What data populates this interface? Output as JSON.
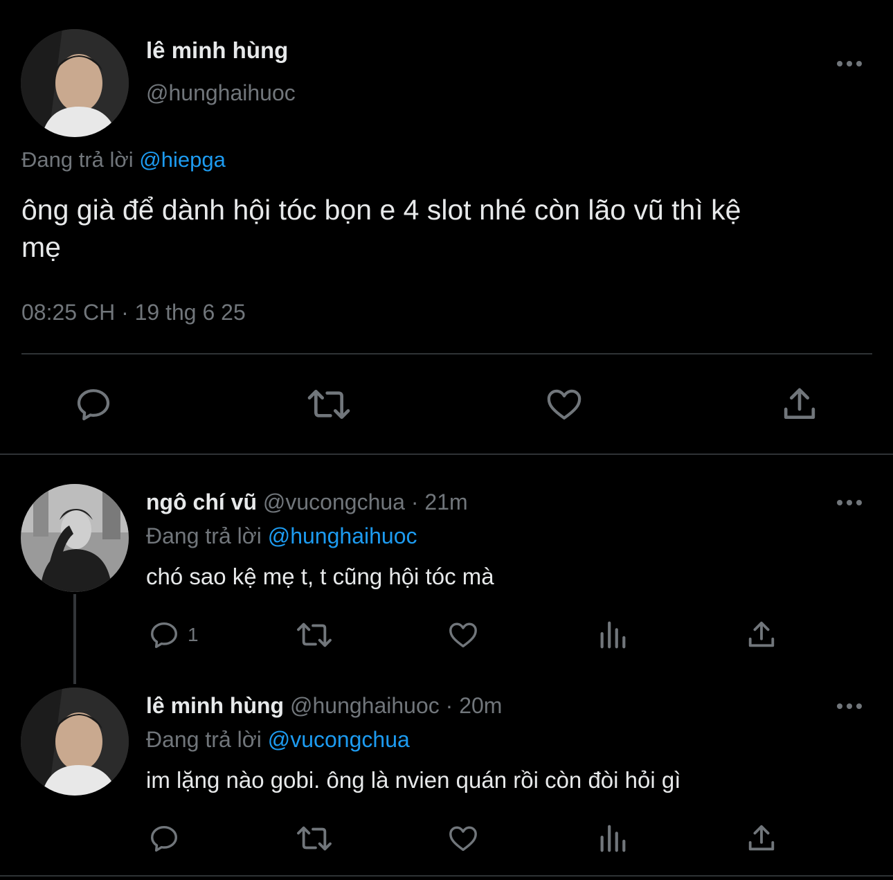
{
  "main_tweet": {
    "author_name": "lê minh hùng",
    "handle": "@hunghaihuoc",
    "reply_prefix": "Đang trả lời",
    "reply_to": "@hiepga",
    "text_line1": "ông già để dành hội tóc bọn e 4 slot nhé còn lão vũ thì kệ",
    "text_line2": "mẹ",
    "timestamp": "08:25 CH · 19 thg 6 25"
  },
  "replies": [
    {
      "author_name": "ngô chí vũ",
      "handle": "@vucongchua",
      "time": "· 21m",
      "reply_prefix": "Đang trả lời",
      "reply_to": "@hunghaihuoc",
      "text": "chó sao kệ mẹ t, t cũng hội tóc mà",
      "reply_count": "1"
    },
    {
      "author_name": "lê minh hùng",
      "handle": "@hunghaihuoc",
      "time": "· 20m",
      "reply_prefix": "Đang trả lời",
      "reply_to": "@vucongchua",
      "text": "im lặng nào gobi. ông là nvien quán rồi còn đòi hỏi gì",
      "reply_count": ""
    }
  ],
  "icons": [
    "reply-icon",
    "retweet-icon",
    "like-icon",
    "share-icon",
    "views-icon",
    "more-icon"
  ],
  "colors": {
    "background": "#000000",
    "text": "#e7e9ea",
    "muted": "#71767b",
    "link": "#1d9bf0",
    "divider": "#2f3336"
  }
}
